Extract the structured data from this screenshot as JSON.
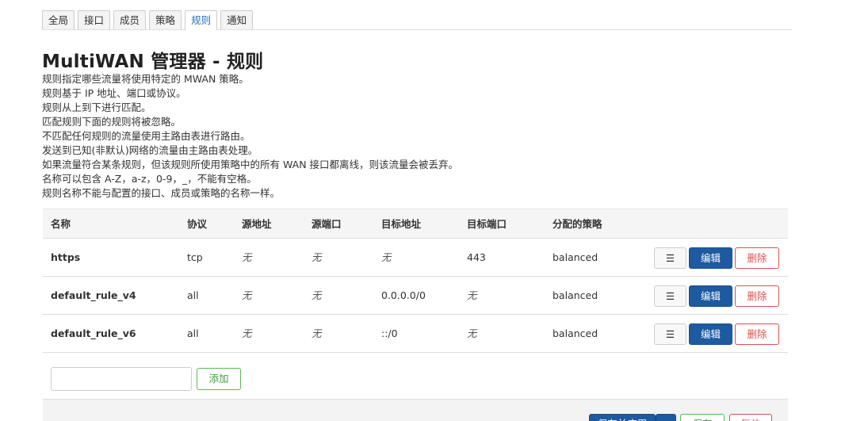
{
  "tabs": [
    "全局",
    "接口",
    "成员",
    "策略",
    "规则",
    "通知"
  ],
  "active_tab": "规则",
  "page": {
    "title": "MultiWAN 管理器 - 规则",
    "description": [
      "规则指定哪些流量将使用特定的 MWAN 策略。",
      "规则基于 IP 地址、端口或协议。",
      "规则从上到下进行匹配。",
      "匹配规则下面的规则将被忽略。",
      "不匹配任何规则的流量使用主路由表进行路由。",
      "发送到已知(非默认)网络的流量由主路由表处理。",
      "如果流量符合某条规则，但该规则所使用策略中的所有 WAN 接口都离线，则该流量会被丢弃。",
      "名称可以包含 A-Z，a-z，0-9，_，不能有空格。",
      "规则名称不能与配置的接口、成员或策略的名称一样。"
    ]
  },
  "table": {
    "headers": {
      "name": "名称",
      "proto": "协议",
      "src": "源地址",
      "sport": "源端口",
      "dst": "目标地址",
      "dport": "目标端口",
      "policy": "分配的策略"
    },
    "rows": [
      {
        "name": "https",
        "proto": "tcp",
        "src": "无",
        "sport": "无",
        "dst": "无",
        "dport": "443",
        "policy": "balanced"
      },
      {
        "name": "default_rule_v4",
        "proto": "all",
        "src": "无",
        "sport": "无",
        "dst": "0.0.0.0/0",
        "dport": "无",
        "policy": "balanced"
      },
      {
        "name": "default_rule_v6",
        "proto": "all",
        "src": "无",
        "sport": "无",
        "dst": "::/0",
        "dport": "无",
        "policy": "balanced"
      }
    ],
    "none_value": "无",
    "buttons": {
      "menu": "☰",
      "edit": "编辑",
      "delete": "删除"
    }
  },
  "add": {
    "input_value": "",
    "button": "添加"
  },
  "footer": {
    "apply": "保存并应用",
    "save": "保存",
    "reset": "复位"
  },
  "colors": {
    "primary": "#1d5aa0",
    "danger": "#d9534f",
    "success": "#5cb85c",
    "active_tab": "#2a6fb8"
  }
}
